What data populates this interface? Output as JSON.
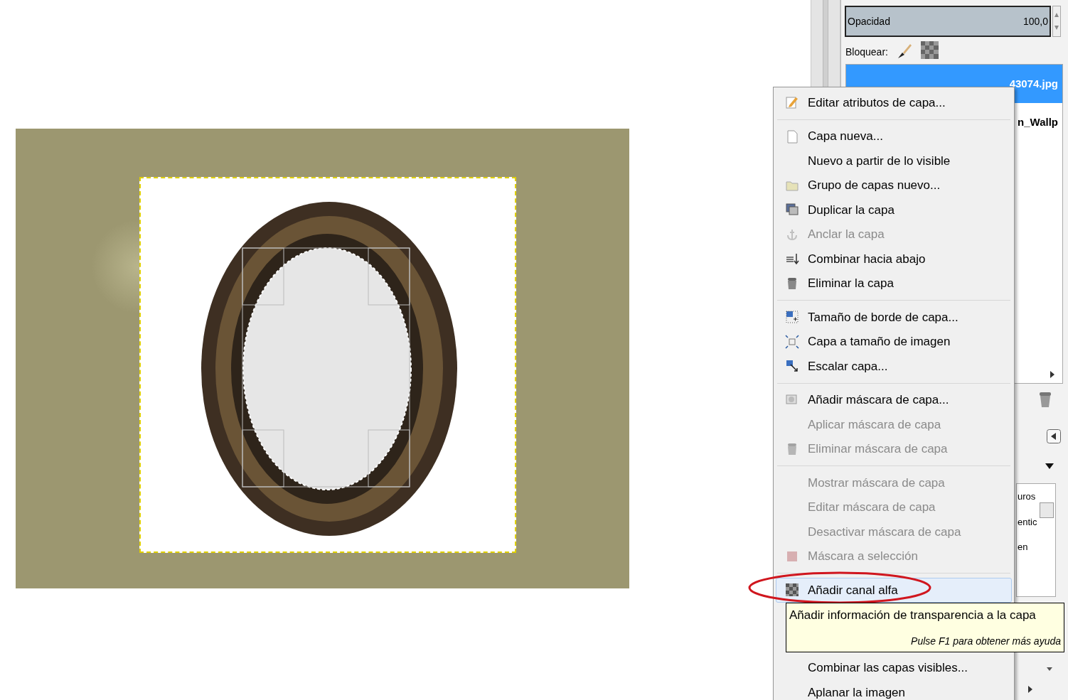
{
  "layers_panel": {
    "opacity": {
      "label": "Opacidad",
      "value": "100,0",
      "level": 1
    },
    "lock_label": "Bloquear:",
    "layers": [
      {
        "name": "43074.jpg",
        "selected": true
      },
      {
        "name": "n_Wallp",
        "selected": false
      }
    ],
    "list_fragments": [
      "uros",
      "entic",
      "en"
    ]
  },
  "context_menu": {
    "items": [
      {
        "kind": "pencil",
        "label": "Editar atributos de capa...",
        "disabled": false,
        "selected": false
      },
      {
        "kind": "separator"
      },
      {
        "kind": "page",
        "label": "Capa nueva...",
        "disabled": false,
        "selected": false
      },
      {
        "kind": "plain",
        "label": "Nuevo a partir de lo visible",
        "disabled": false,
        "selected": false
      },
      {
        "kind": "folder",
        "label": "Grupo de capas nuevo...",
        "disabled": false,
        "selected": false
      },
      {
        "kind": "duplicate",
        "label": "Duplicar la capa",
        "disabled": false,
        "selected": false
      },
      {
        "kind": "anchor",
        "label": "Anclar la capa",
        "disabled": true,
        "selected": false
      },
      {
        "kind": "merge",
        "label": "Combinar hacia abajo",
        "disabled": false,
        "selected": false
      },
      {
        "kind": "trash",
        "label": "Eliminar la capa",
        "disabled": false,
        "selected": false
      },
      {
        "kind": "separator"
      },
      {
        "kind": "border",
        "label": "Tamaño de borde de capa...",
        "disabled": false,
        "selected": false
      },
      {
        "kind": "fit",
        "label": "Capa a tamaño de imagen",
        "disabled": false,
        "selected": false
      },
      {
        "kind": "scale",
        "label": "Escalar capa...",
        "disabled": false,
        "selected": false
      },
      {
        "kind": "separator"
      },
      {
        "kind": "mask",
        "label": "Añadir máscara de capa...",
        "disabled": false,
        "selected": false
      },
      {
        "kind": "plain",
        "label": "Aplicar máscara de capa",
        "disabled": true,
        "selected": false
      },
      {
        "kind": "trash",
        "label": "Eliminar máscara de capa",
        "disabled": true,
        "selected": false
      },
      {
        "kind": "separator"
      },
      {
        "kind": "plain",
        "label": "Mostrar máscara de capa",
        "disabled": true,
        "selected": false
      },
      {
        "kind": "plain",
        "label": "Editar máscara de capa",
        "disabled": true,
        "selected": false
      },
      {
        "kind": "plain",
        "label": "Desactivar máscara de capa",
        "disabled": true,
        "selected": false
      },
      {
        "kind": "maskselect",
        "label": "Máscara a selección",
        "disabled": true,
        "selected": false
      },
      {
        "kind": "separator"
      },
      {
        "kind": "checker",
        "label": "Añadir canal alfa",
        "disabled": false,
        "selected": true
      },
      {
        "kind": "hidden"
      },
      {
        "kind": "plain",
        "label": "Combinar las capas visibles...",
        "disabled": false,
        "selected": false
      },
      {
        "kind": "plain",
        "label": "Aplanar la imagen",
        "disabled": false,
        "selected": false
      }
    ]
  },
  "tooltip": {
    "text": "Añadir información de transparencia a la capa",
    "hint": "Pulse F1 para obtener más ayuda"
  }
}
